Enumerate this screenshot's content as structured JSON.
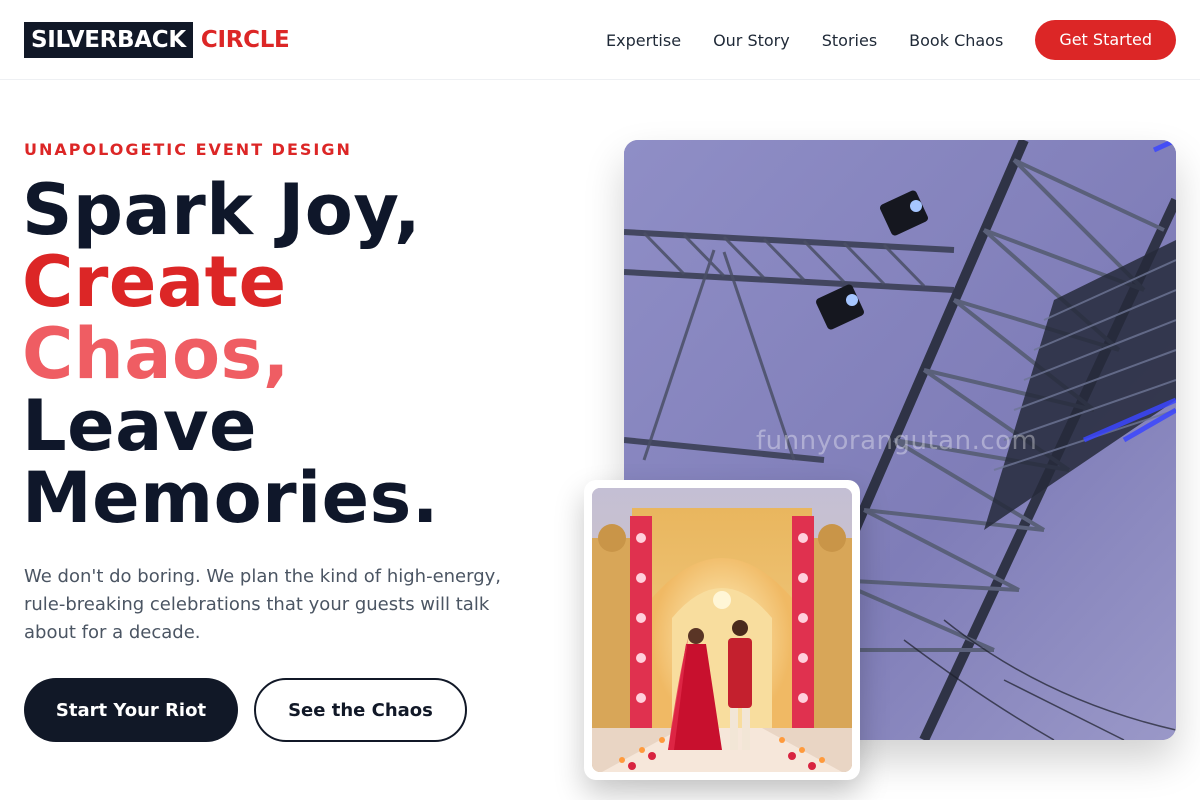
{
  "brand": {
    "name": "SILVERBACK",
    "accent": "CIRCLE"
  },
  "nav": {
    "items": [
      "Expertise",
      "Our Story",
      "Stories",
      "Book Chaos"
    ],
    "cta": "Get Started"
  },
  "hero": {
    "eyebrow": "UNAPOLOGETIC EVENT DESIGN",
    "headline": {
      "line1": "Spark Joy,",
      "line2": "Create",
      "line3": "Chaos,",
      "line4": "Leave",
      "line5": "Memories."
    },
    "description": "We don't do boring. We plan the kind of high-energy, rule-breaking celebrations that your guests will talk about for a decade.",
    "primary_button": "Start Your Riot",
    "secondary_button": "See the Chaos"
  },
  "media": {
    "main_image": "stage-truss-lighting-image",
    "watermark": "funnyorangutan.com",
    "inset_image": "wedding-couple-palace-image"
  },
  "colors": {
    "accent": "#dc2626",
    "accent_light": "#ef5d63",
    "dark": "#111827"
  }
}
